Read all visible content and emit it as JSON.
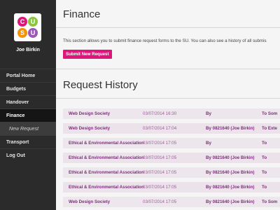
{
  "sidebar": {
    "user_name": "Joe Birkin",
    "logo_letters": [
      "C",
      "U",
      "S",
      "U"
    ],
    "logo_colors": [
      "#e0157c",
      "#8cc63f",
      "#f39200",
      "#9b59b6"
    ],
    "nav": [
      {
        "label": "Portal Home"
      },
      {
        "label": "Budgets"
      },
      {
        "label": "Handover"
      },
      {
        "label": "Finance"
      },
      {
        "label": "New Request"
      },
      {
        "label": "Transport"
      },
      {
        "label": "Log Out"
      }
    ]
  },
  "main": {
    "title": "Finance",
    "description": "This section allows you to submit finance request forms to the SU. You can also see a history of all submis",
    "submit_button": "Submit New Request",
    "history_title": "Request History"
  },
  "history": [
    {
      "society": "Web Design Society",
      "date": "03/07/2014 16:30",
      "by": "By",
      "to": "To Som"
    },
    {
      "society": "Web Design Society",
      "date": "03/07/2014 17:04",
      "by": "By 0821640 (Joe Birkin)",
      "to": "To Exte"
    },
    {
      "society": "Ethical & Environmental Association",
      "date": "03/07/2014 17:05",
      "by": "By",
      "to": "To"
    },
    {
      "society": "Ethical & Environmental Association",
      "date": "03/07/2014 17:05",
      "by": "By 0821640 (Joe Birkin)",
      "to": "To"
    },
    {
      "society": "Ethical & Environmental Association",
      "date": "03/07/2014 17:05",
      "by": "By 0821640 (Joe Birkin)",
      "to": "To"
    },
    {
      "society": "Ethical & Environmental Association",
      "date": "03/07/2014 17:05",
      "by": "By 0821640 (Joe Birkin)",
      "to": "To"
    },
    {
      "society": "Web Design Society",
      "date": "03/07/2014 17:05",
      "by": "By 0821640 (Joe Birkin)",
      "to": "To Som"
    }
  ]
}
